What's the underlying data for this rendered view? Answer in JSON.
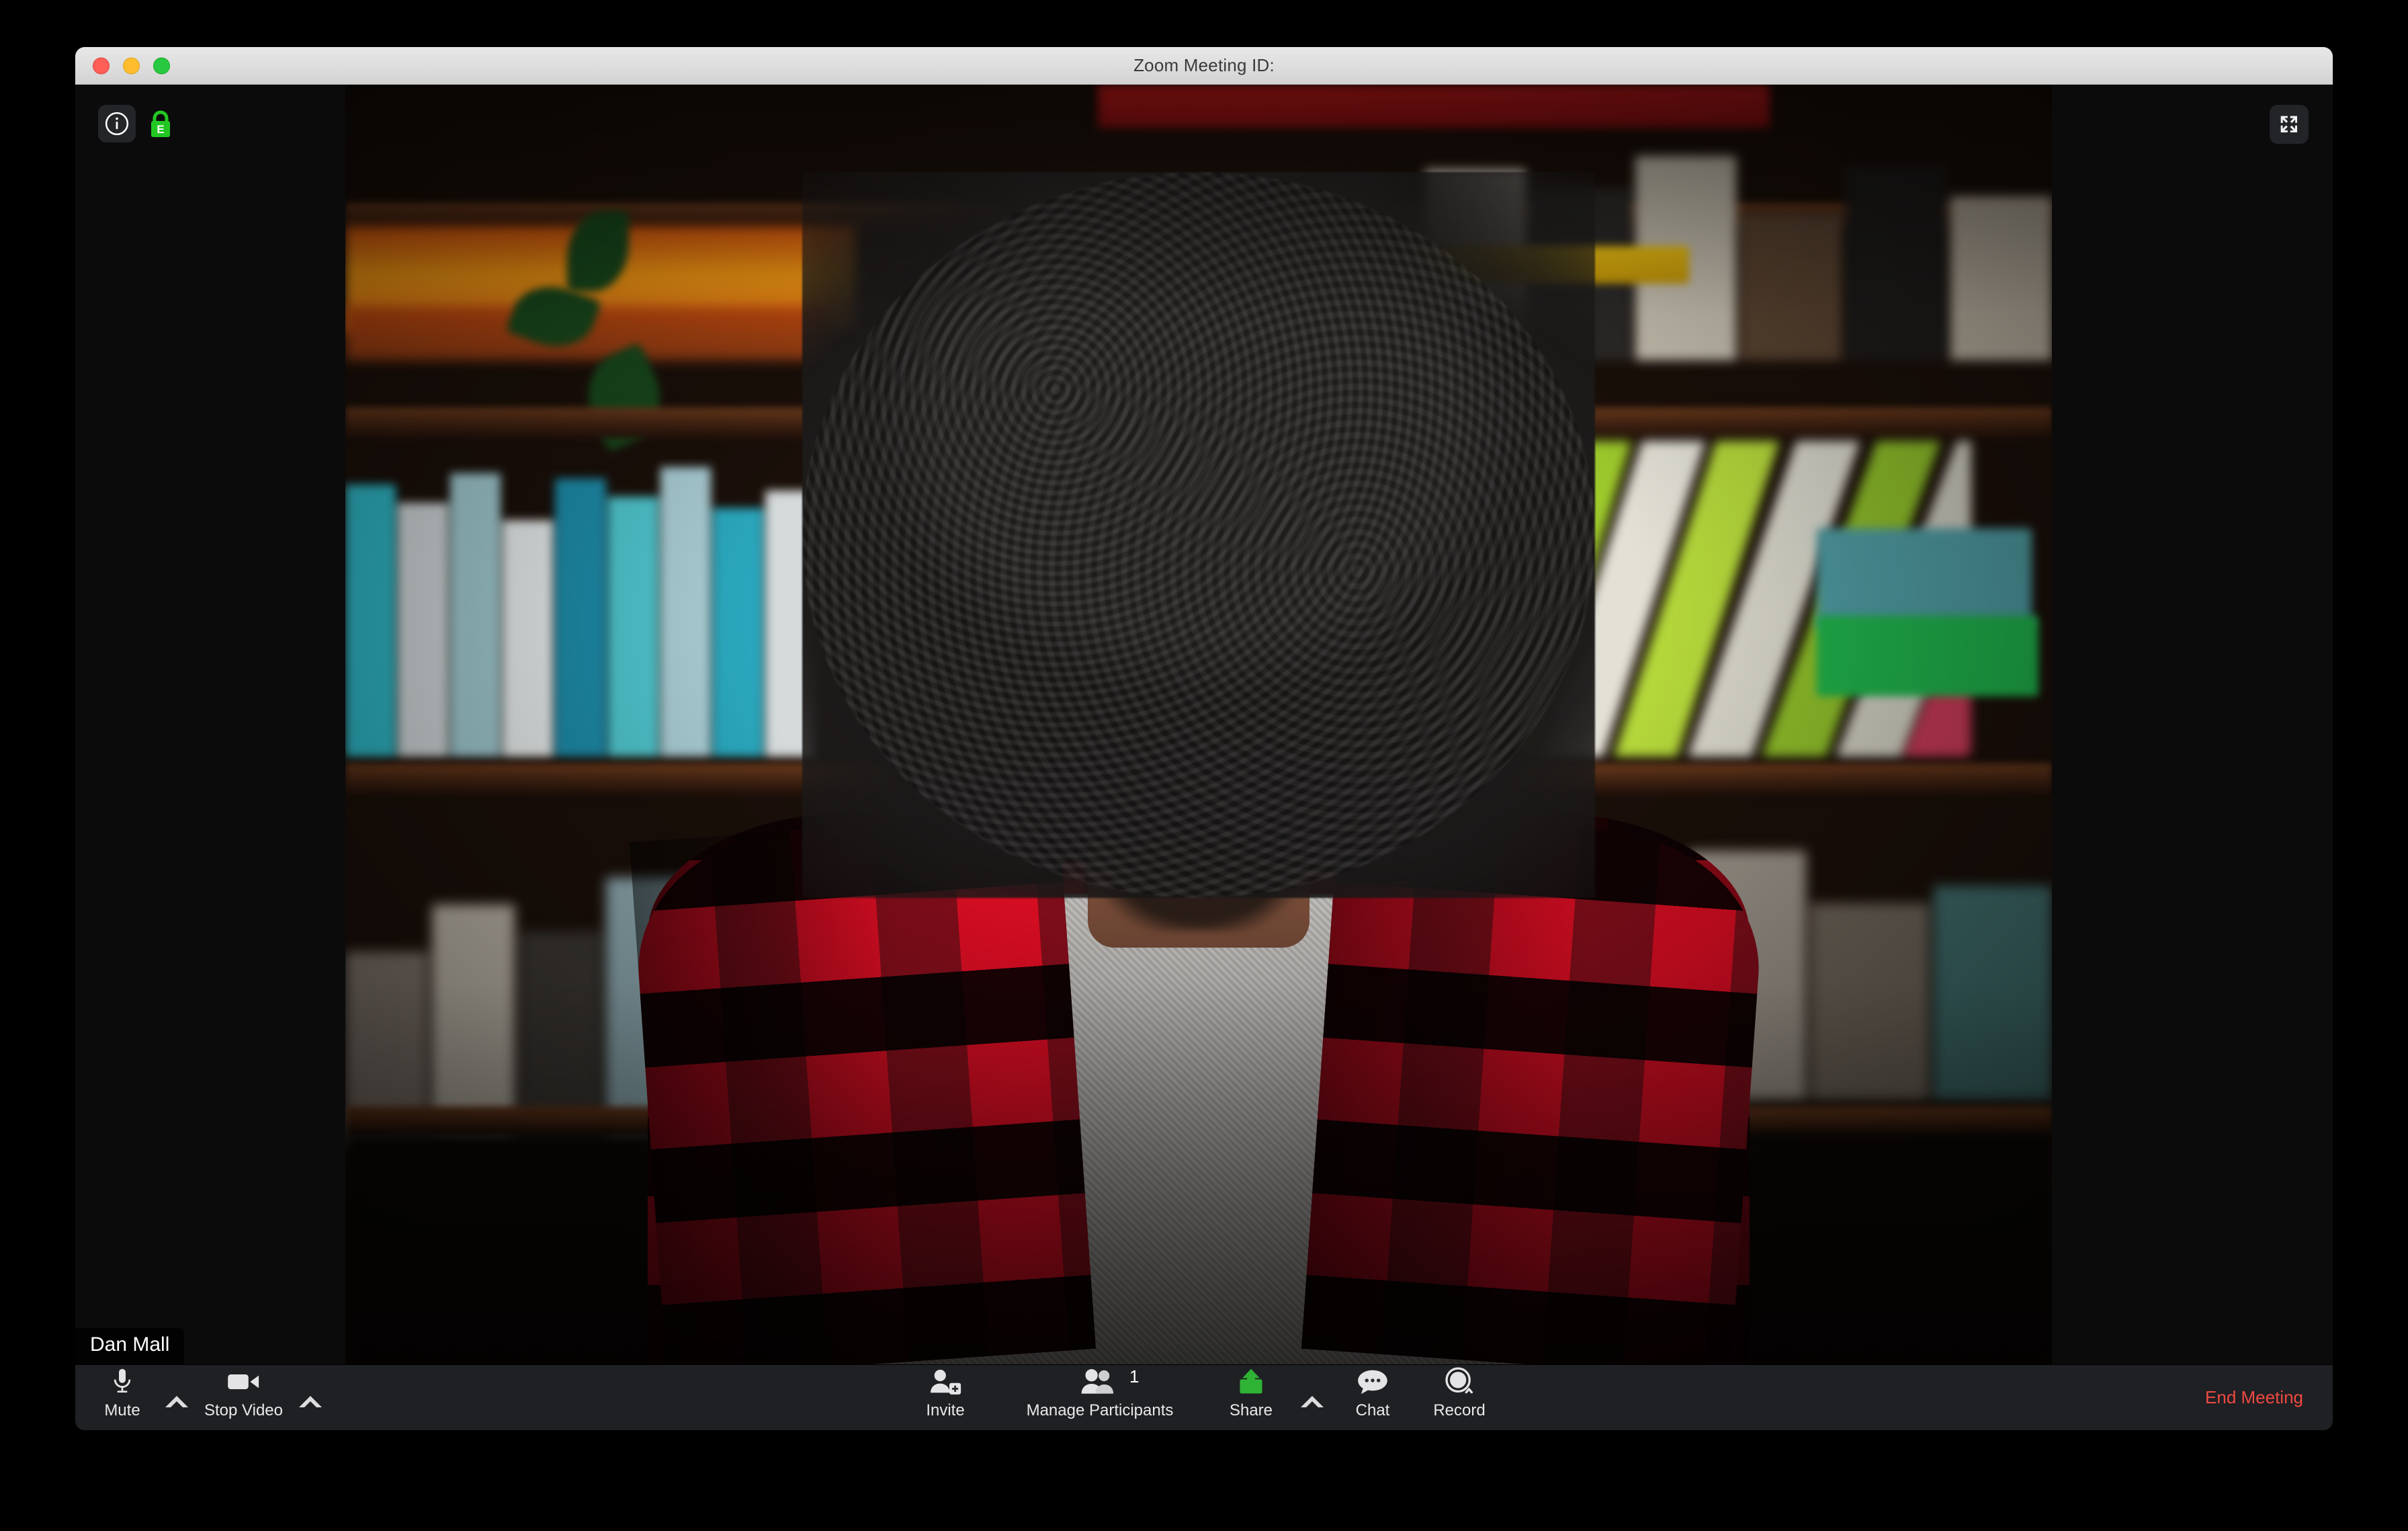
{
  "window": {
    "title": "Zoom Meeting ID:",
    "traffic_lights": [
      {
        "name": "close",
        "color": "#ff5f57"
      },
      {
        "name": "minimize",
        "color": "#ffbd2e"
      },
      {
        "name": "maximize",
        "color": "#28c840"
      }
    ]
  },
  "video": {
    "participant_name": "Dan Mall",
    "overlays": {
      "info_icon": "info-circle-icon",
      "encryption_icon": "green-lock-icon",
      "encryption_letter": "E",
      "fullscreen_icon": "enter-fullscreen-icon"
    }
  },
  "toolbar": {
    "background": "#1f2023",
    "left_controls": [
      {
        "label": "Mute",
        "icon": "microphone-icon",
        "has_caret": true
      },
      {
        "label": "Stop Video",
        "icon": "video-camera-icon",
        "has_caret": true
      }
    ],
    "center_controls": [
      {
        "label": "Invite",
        "icon": "person-add-icon",
        "has_caret": false,
        "badge": ""
      },
      {
        "label": "Manage Participants",
        "icon": "people-icon",
        "has_caret": false,
        "badge": "1"
      },
      {
        "label": "Share",
        "icon": "share-screen-icon",
        "has_caret": true,
        "badge": ""
      },
      {
        "label": "Chat",
        "icon": "chat-bubble-icon",
        "has_caret": false,
        "badge": ""
      },
      {
        "label": "Record",
        "icon": "record-circle-icon",
        "has_caret": false,
        "badge": ""
      }
    ],
    "end_meeting_label": "End Meeting",
    "end_meeting_color": "#ef4a42",
    "share_color": "#2fb335"
  }
}
